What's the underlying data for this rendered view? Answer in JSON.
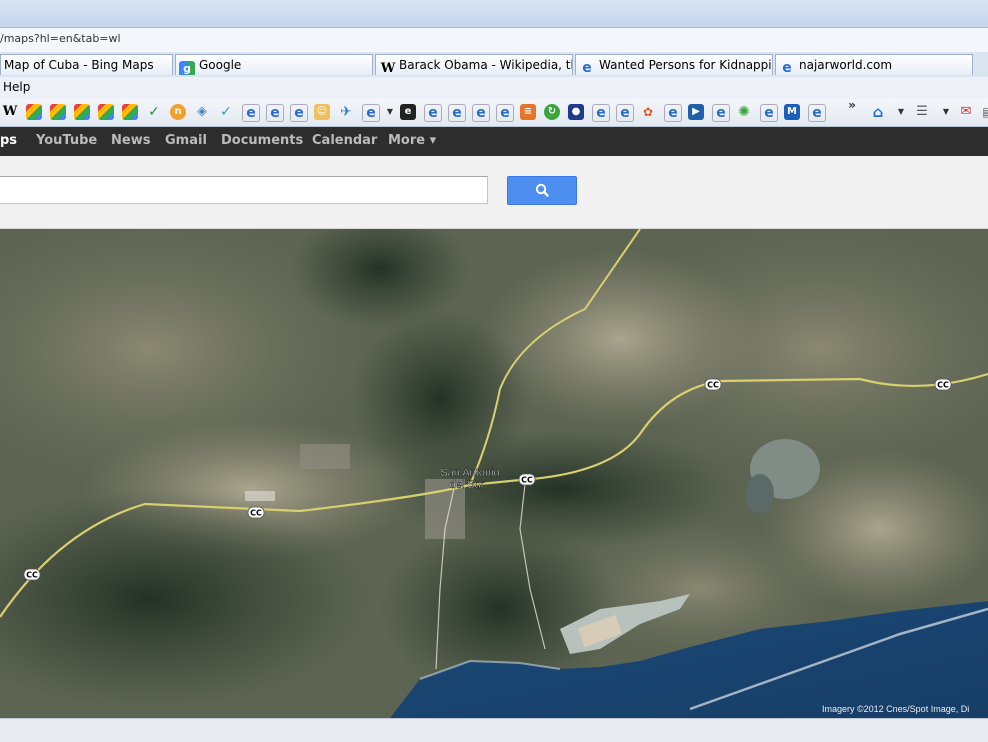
{
  "browser": {
    "url": "/maps?hl=en&tab=wl",
    "tabs": [
      {
        "label": "Map of Cuba - Bing Maps"
      },
      {
        "label": "Google"
      },
      {
        "label": "Barack Obama - Wikipedia, th..."
      },
      {
        "label": "Wanted Persons for Kidnapping"
      },
      {
        "label": "najarworld.com"
      }
    ],
    "menu": {
      "help": "Help"
    },
    "toolbar_overflow": "»"
  },
  "gbar": {
    "items": [
      "ps",
      "YouTube",
      "News",
      "Gmail",
      "Documents",
      "Calendar",
      "More ▾"
    ]
  },
  "search": {
    "value": "",
    "button_icon": "search-icon"
  },
  "map": {
    "place_label_1": "San Antonio",
    "place_label_2": "del Sur",
    "road_shield": "CC",
    "attribution": "Imagery ©2012 Cnes/Spot Image, Di"
  },
  "colors": {
    "gbar": "#2d2d2d",
    "search_button": "#4d8ff1",
    "road": "#d8cf6e"
  }
}
